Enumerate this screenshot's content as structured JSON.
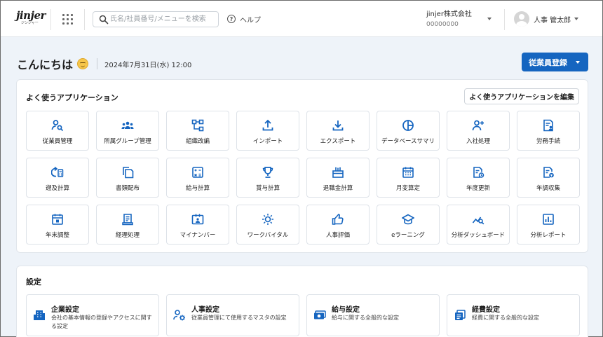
{
  "header": {
    "logo_text": "jinjer",
    "logo_sub": "ジンジャー",
    "search_placeholder": "氏名/社員番号/メニューを検索",
    "help_label": "ヘルプ",
    "company_name": "jinjer株式会社",
    "company_code": "00000000",
    "user_name": "人事 管太郎"
  },
  "greeting": {
    "hello": "こんにちは",
    "datetime": "2024年7月31日(水) 12:00",
    "register_button": "従業員登録"
  },
  "apps": {
    "title": "よく使うアプリケーション",
    "edit_button": "よく使うアプリケーションを編集",
    "items": [
      {
        "label": "従業員管理",
        "icon": "person-search-icon"
      },
      {
        "label": "所属グループ管理",
        "icon": "group-icon"
      },
      {
        "label": "組織改編",
        "icon": "org-chart-icon"
      },
      {
        "label": "インポート",
        "icon": "upload-icon"
      },
      {
        "label": "エクスポート",
        "icon": "download-icon"
      },
      {
        "label": "データベースサマリ",
        "icon": "pie-chart-icon"
      },
      {
        "label": "入社処理",
        "icon": "person-add-icon"
      },
      {
        "label": "労務手続",
        "icon": "document-person-icon"
      },
      {
        "label": "遡及計算",
        "icon": "retro-calc-icon"
      },
      {
        "label": "書類配布",
        "icon": "documents-icon"
      },
      {
        "label": "給与計算",
        "icon": "calculator-icon"
      },
      {
        "label": "賞与計算",
        "icon": "trophy-icon"
      },
      {
        "label": "退職金計算",
        "icon": "gift-icon"
      },
      {
        "label": "月変算定",
        "icon": "calendar-icon"
      },
      {
        "label": "年度更新",
        "icon": "doc-refresh-icon"
      },
      {
        "label": "年調収集",
        "icon": "doc-money-icon"
      },
      {
        "label": "年末調整",
        "icon": "calendar-check-icon"
      },
      {
        "label": "経理処理",
        "icon": "receipt-icon"
      },
      {
        "label": "マイナンバー",
        "icon": "id-card-icon"
      },
      {
        "label": "ワークバイタル",
        "icon": "sun-icon"
      },
      {
        "label": "人事評価",
        "icon": "thumbs-up-icon"
      },
      {
        "label": "eラーニング",
        "icon": "graduation-cap-icon"
      },
      {
        "label": "分析ダッシュボード",
        "icon": "analytics-icon"
      },
      {
        "label": "分析レポート",
        "icon": "bar-chart-icon"
      }
    ]
  },
  "settings": {
    "title": "設定",
    "items": [
      {
        "title": "企業設定",
        "desc": "会社の基本情報の登録やアクセスに関する設定",
        "icon": "building-icon"
      },
      {
        "title": "人事設定",
        "desc": "従業員管理にて使用するマスタの設定",
        "icon": "person-gear-icon"
      },
      {
        "title": "給与設定",
        "desc": "給与に関する全般的な設定",
        "icon": "money-icon"
      },
      {
        "title": "経費設定",
        "desc": "経費に関する全般的な設定",
        "icon": "expense-icon"
      }
    ]
  },
  "colors": {
    "primary": "#1565c0",
    "icon": "#1565c0",
    "background": "#eef3f9"
  }
}
